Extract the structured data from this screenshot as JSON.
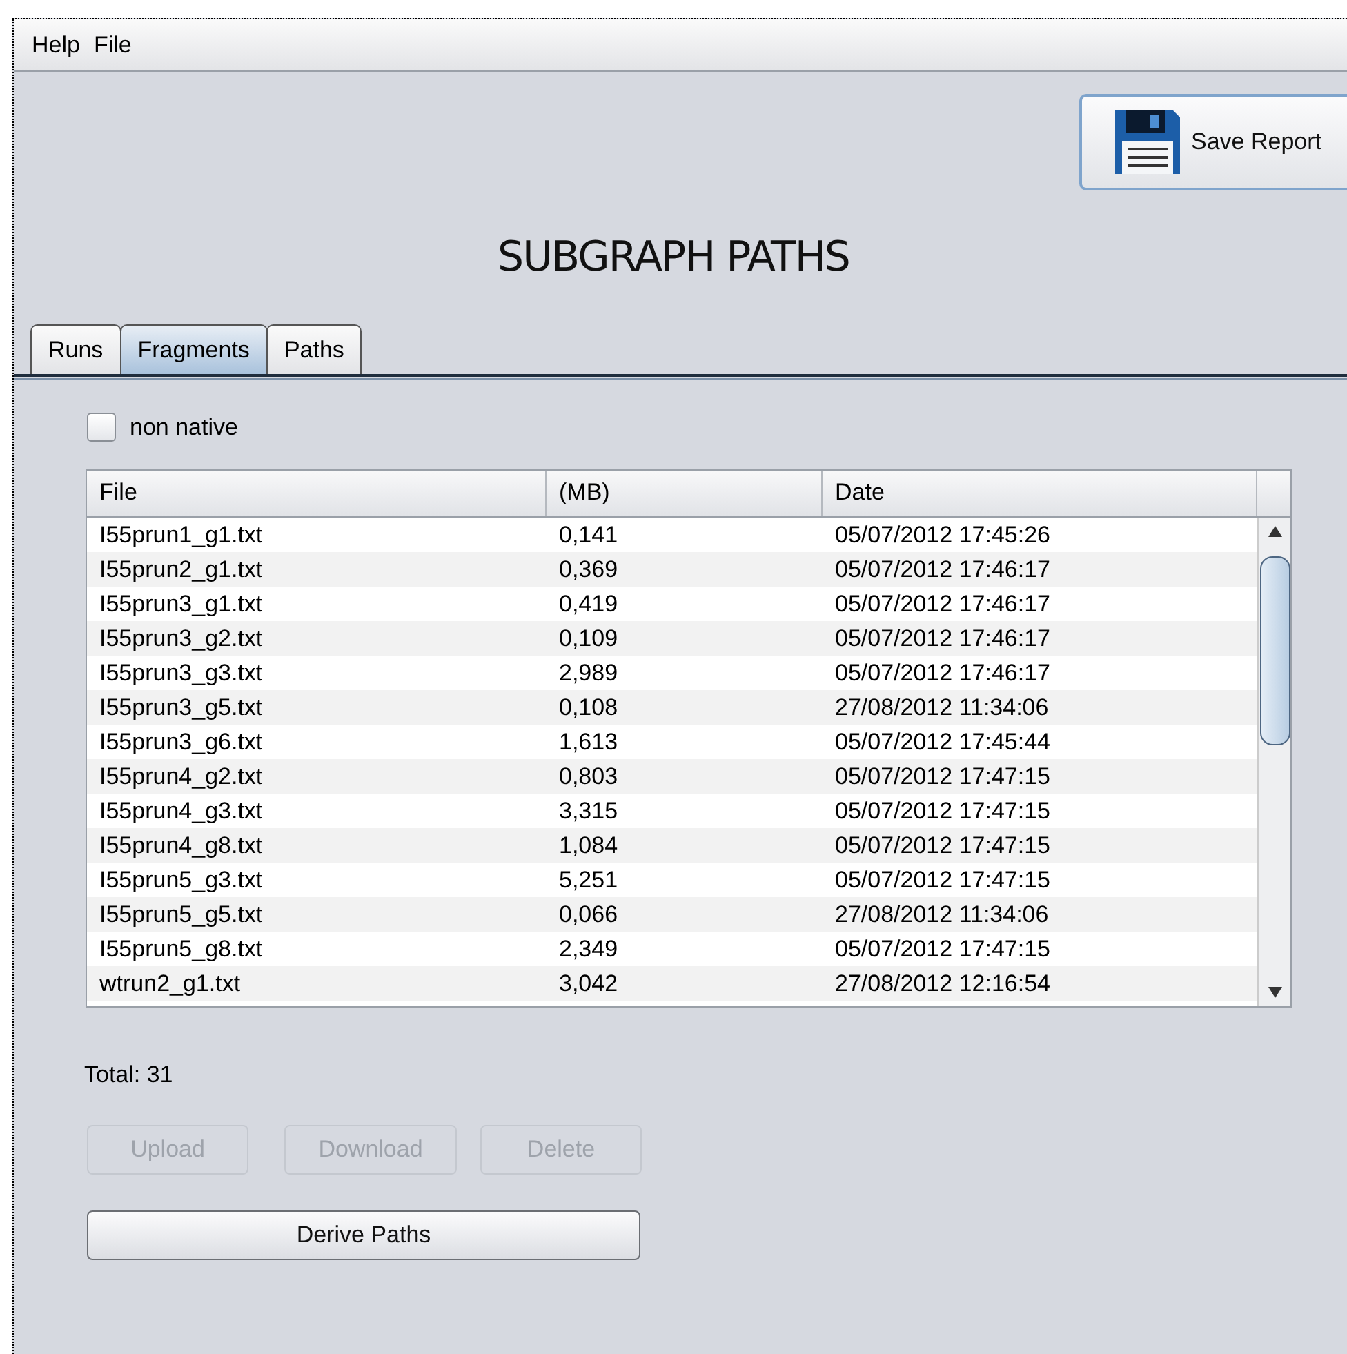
{
  "menu": [
    "Help",
    "File"
  ],
  "save_button": {
    "label": "Save Report"
  },
  "title": "SUBGRAPH PATHS",
  "tabs": [
    {
      "label": "Runs",
      "selected": false
    },
    {
      "label": "Fragments",
      "selected": true
    },
    {
      "label": "Paths",
      "selected": false
    }
  ],
  "non_native": {
    "label": "non native",
    "checked": false
  },
  "table": {
    "columns": [
      "File",
      "(MB)",
      "Date"
    ],
    "rows": [
      [
        "I55prun1_g1.txt",
        "0,141",
        "05/07/2012 17:45:26"
      ],
      [
        "I55prun2_g1.txt",
        "0,369",
        "05/07/2012 17:46:17"
      ],
      [
        "I55prun3_g1.txt",
        "0,419",
        "05/07/2012 17:46:17"
      ],
      [
        "I55prun3_g2.txt",
        "0,109",
        "05/07/2012 17:46:17"
      ],
      [
        "I55prun3_g3.txt",
        "2,989",
        "05/07/2012 17:46:17"
      ],
      [
        "I55prun3_g5.txt",
        "0,108",
        "27/08/2012 11:34:06"
      ],
      [
        "I55prun3_g6.txt",
        "1,613",
        "05/07/2012 17:45:44"
      ],
      [
        "I55prun4_g2.txt",
        "0,803",
        "05/07/2012 17:47:15"
      ],
      [
        "I55prun4_g3.txt",
        "3,315",
        "05/07/2012 17:47:15"
      ],
      [
        "I55prun4_g8.txt",
        "1,084",
        "05/07/2012 17:47:15"
      ],
      [
        "I55prun5_g3.txt",
        "5,251",
        "05/07/2012 17:47:15"
      ],
      [
        "I55prun5_g5.txt",
        "0,066",
        "27/08/2012 11:34:06"
      ],
      [
        "I55prun5_g8.txt",
        "2,349",
        "05/07/2012 17:47:15"
      ],
      [
        "wtrun2_g1.txt",
        "3,042",
        "27/08/2012 12:16:54"
      ]
    ]
  },
  "total": "Total: 31",
  "buttons": [
    {
      "label": "Upload",
      "disabled": true
    },
    {
      "label": "Download",
      "disabled": true
    },
    {
      "label": "Delete",
      "disabled": true
    }
  ],
  "derive_button": {
    "label": "Derive Paths",
    "disabled": false
  }
}
